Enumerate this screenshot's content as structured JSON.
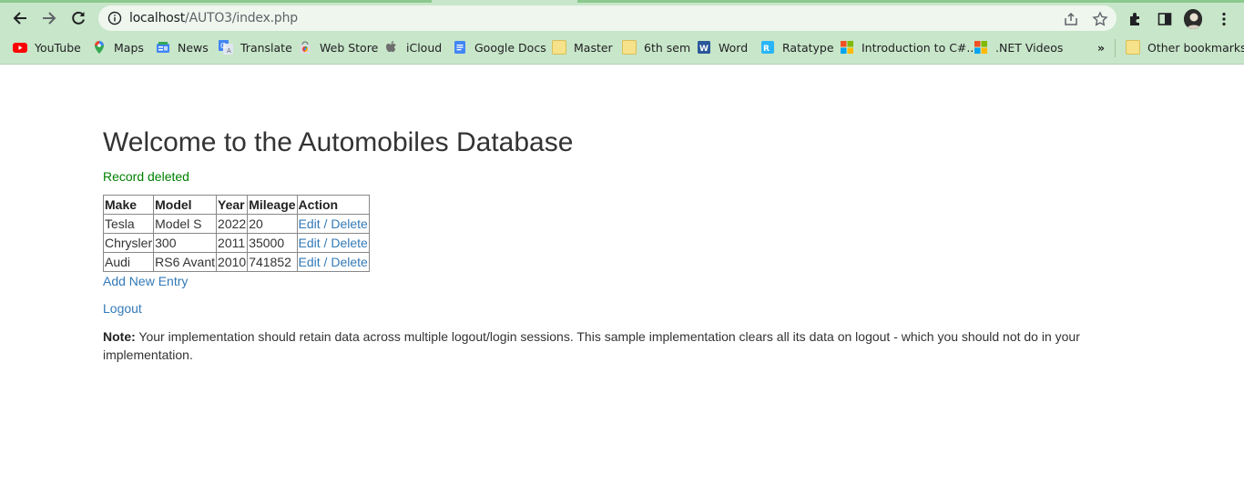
{
  "browser": {
    "url_host": "localhost",
    "url_path": "/AUTO3/index.php",
    "bookmarks": [
      {
        "label": "YouTube",
        "icon": "youtube-icon"
      },
      {
        "label": "Maps",
        "icon": "maps-icon"
      },
      {
        "label": "News",
        "icon": "news-icon"
      },
      {
        "label": "Translate",
        "icon": "translate-icon"
      },
      {
        "label": "Web Store",
        "icon": "web-store-icon"
      },
      {
        "label": "iCloud",
        "icon": "apple-icon"
      },
      {
        "label": "Google Docs",
        "icon": "google-docs-icon"
      },
      {
        "label": "Master",
        "icon": "folder-icon"
      },
      {
        "label": "6th sem",
        "icon": "folder-icon"
      },
      {
        "label": "Word",
        "icon": "word-icon"
      },
      {
        "label": "Ratatype",
        "icon": "ratatype-icon"
      },
      {
        "label": "Introduction to C#...",
        "icon": "microsoft-icon"
      },
      {
        "label": ".NET Videos",
        "icon": "microsoft-icon"
      }
    ],
    "more_bookmarks": "»",
    "other_bookmarks": "Other bookmarks"
  },
  "page": {
    "title": "Welcome to the Automobiles Database",
    "flash": "Record deleted",
    "table": {
      "headers": [
        "Make",
        "Model",
        "Year",
        "Mileage",
        "Action"
      ],
      "rows": [
        {
          "make": "Tesla",
          "model": "Model S",
          "year": "2022",
          "mileage": "20",
          "edit": "Edit",
          "sep": " / ",
          "delete": "Delete"
        },
        {
          "make": "Chrysler",
          "model": "300",
          "year": "2011",
          "mileage": "35000",
          "edit": "Edit",
          "sep": " / ",
          "delete": "Delete"
        },
        {
          "make": "Audi",
          "model": "RS6 Avant",
          "year": "2010",
          "mileage": "741852",
          "edit": "Edit",
          "sep": " / ",
          "delete": "Delete"
        }
      ]
    },
    "add_link": "Add New Entry",
    "logout_link": "Logout",
    "note_label": "Note:",
    "note_text": " Your implementation should retain data across multiple logout/login sessions. This sample implementation clears all its data on logout - which you should not do in your implementation."
  },
  "colors": {
    "chrome_bg": "#c8e6c9",
    "link": "#337ab7",
    "flash": "#008000"
  }
}
